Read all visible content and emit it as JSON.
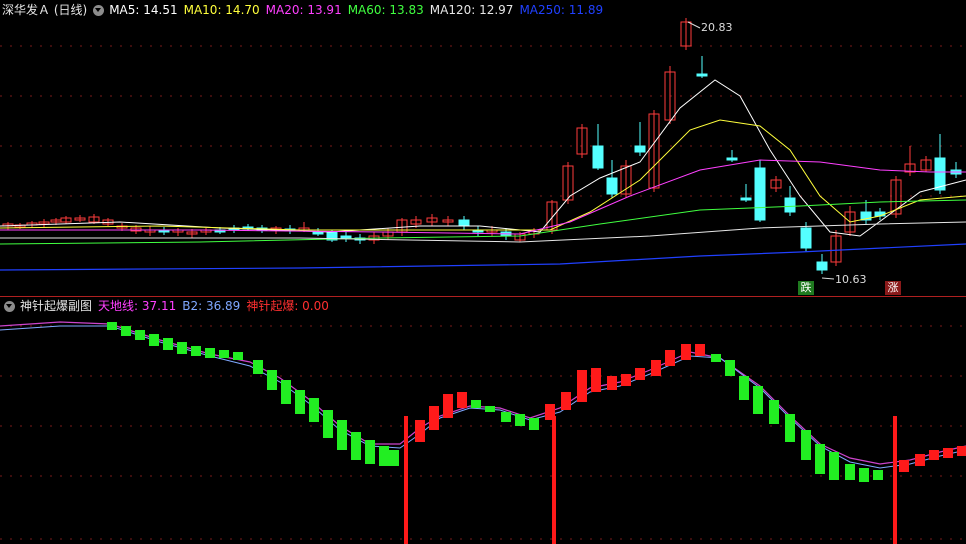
{
  "main": {
    "title": "深华发Ａ (日线)",
    "ma": [
      {
        "label": "MA5: 14.51",
        "color": "#ffffff"
      },
      {
        "label": "MA10: 14.70",
        "color": "#ffff3c"
      },
      {
        "label": "MA20: 13.91",
        "color": "#ff40ff"
      },
      {
        "label": "MA60: 13.83",
        "color": "#40ff40"
      },
      {
        "label": "MA120: 12.97",
        "color": "#e6e6e6"
      },
      {
        "label": "MA250: 11.89",
        "color": "#2040ff"
      }
    ],
    "high_label": "20.83",
    "low_label": "10.63",
    "marker_down": "跌",
    "marker_up": "涨",
    "colors": {
      "up": "#ff3c3c",
      "down": "#54ffff",
      "grid": "#7a1a1a"
    }
  },
  "sub": {
    "title": "神针起爆副图",
    "items": [
      {
        "label": "天地线: 37.11",
        "color": "#ff40ff"
      },
      {
        "label": "B2: 36.89",
        "color": "#7fa8ff"
      },
      {
        "label": "神针起爆: 0.00",
        "color": "#ff3030"
      }
    ],
    "colors": {
      "rise": "#ff1a1a",
      "fall": "#22ee22",
      "line": "#cc44cc"
    }
  }
}
